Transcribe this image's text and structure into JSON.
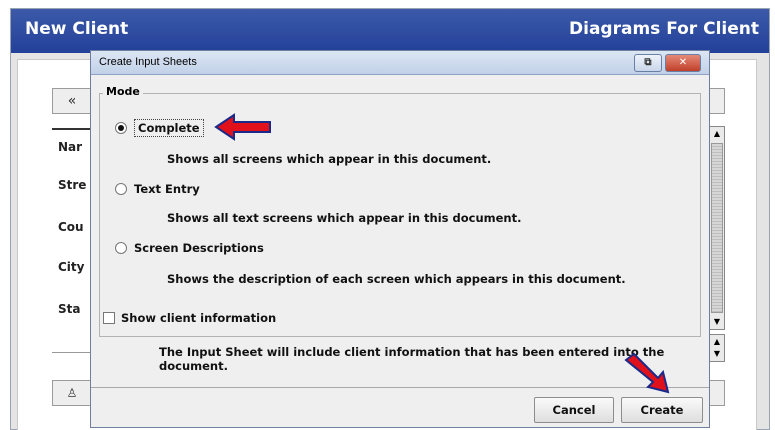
{
  "app": {
    "title": "New Client",
    "title_right": "Diagrams For Client",
    "nav_back_glyph": "«",
    "bg_labels": [
      "Nar",
      "Stre",
      "Cou",
      "City",
      "Sta"
    ],
    "bottom_button_glyph": "♙"
  },
  "dialog": {
    "title": "Create Input Sheets",
    "restore_glyph": "⧉",
    "close_glyph": "✕",
    "mode_legend": "Mode",
    "options": [
      {
        "label": "Complete",
        "description": "Shows all screens which appear in this document.",
        "selected": true
      },
      {
        "label": "Text Entry",
        "description": "Shows all text screens which appear in this document.",
        "selected": false
      },
      {
        "label": "Screen Descriptions",
        "description": "Shows the description of each screen which appears in this document.",
        "selected": false
      }
    ],
    "show_client_info": {
      "label": "Show client information",
      "checked": false,
      "description": "The Input Sheet will include client information that has been entered into the document."
    },
    "buttons": {
      "cancel": "Cancel",
      "create": "Create"
    }
  },
  "colors": {
    "header": "#2e4ca3",
    "annotation_arrow": "#e0111b"
  }
}
